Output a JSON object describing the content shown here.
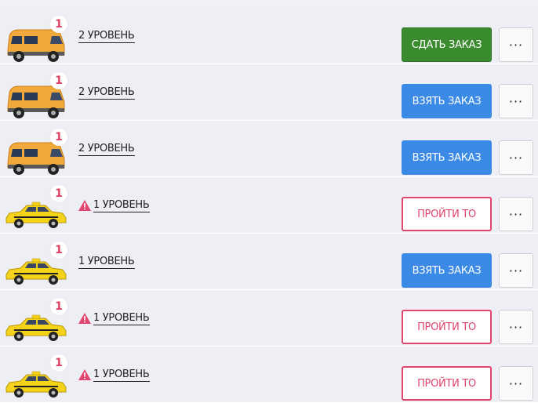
{
  "rows": [
    {
      "vehicle": "van",
      "badge": "1",
      "level": "2 УРОВЕНЬ",
      "warning": false,
      "action": "СДАТЬ ЗАКАЗ",
      "action_style": "green",
      "more": "···"
    },
    {
      "vehicle": "van",
      "badge": "1",
      "level": "2 УРОВЕНЬ",
      "warning": false,
      "action": "ВЗЯТЬ ЗАКАЗ",
      "action_style": "blue",
      "more": "···"
    },
    {
      "vehicle": "van",
      "badge": "1",
      "level": "2 УРОВЕНЬ",
      "warning": false,
      "action": "ВЗЯТЬ ЗАКАЗ",
      "action_style": "blue",
      "more": "···"
    },
    {
      "vehicle": "taxi",
      "badge": "1",
      "level": "1 УРОВЕНЬ",
      "warning": true,
      "action": "ПРОЙТИ ТО",
      "action_style": "pink",
      "more": "···"
    },
    {
      "vehicle": "taxi",
      "badge": "1",
      "level": "1 УРОВЕНЬ",
      "warning": false,
      "action": "ВЗЯТЬ ЗАКАЗ",
      "action_style": "blue",
      "more": "···"
    },
    {
      "vehicle": "taxi",
      "badge": "1",
      "level": "1 УРОВЕНЬ",
      "warning": true,
      "action": "ПРОЙТИ ТО",
      "action_style": "pink",
      "more": "···"
    },
    {
      "vehicle": "taxi",
      "badge": "1",
      "level": "1 УРОВЕНЬ",
      "warning": true,
      "action": "ПРОЙТИ ТО",
      "action_style": "pink",
      "more": "···"
    }
  ],
  "colors": {
    "green": "#3a8a2e",
    "blue": "#3a8ae6",
    "pink": "#e0456d",
    "badge_text": "#e4405f",
    "van_body": "#f2a93b",
    "taxi_body": "#f5d31a"
  },
  "icons": {
    "van": "minibus-icon",
    "taxi": "taxi-car-icon",
    "warning": "warning-triangle-icon"
  }
}
